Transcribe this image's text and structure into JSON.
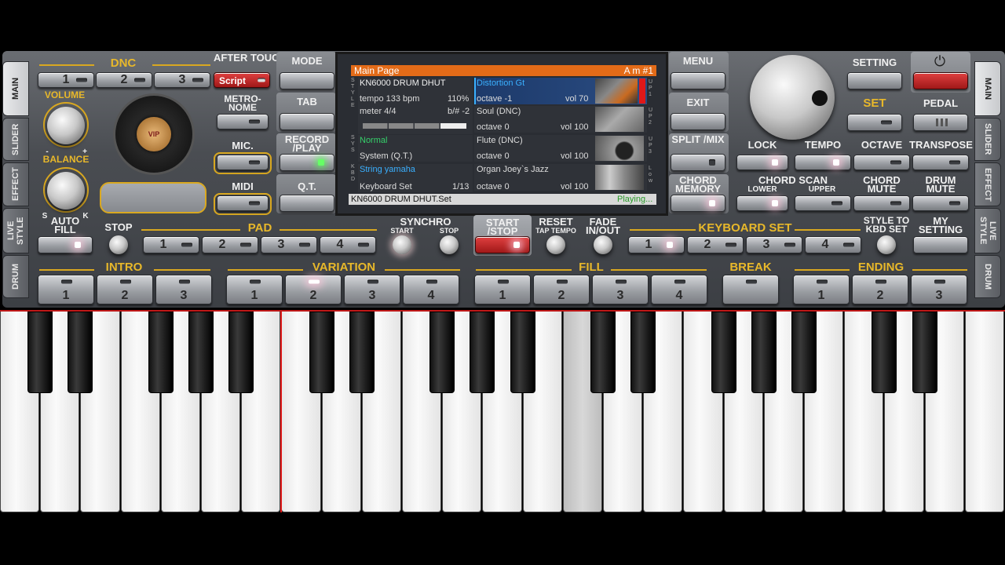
{
  "side_tabs_left": [
    "MAIN",
    "SLIDER",
    "EFFECT",
    "LIVE STYLE",
    "DRUM"
  ],
  "side_tabs_right": [
    "MAIN",
    "SLIDER",
    "EFFECT",
    "LIVE STYLE",
    "DRUM"
  ],
  "dnc": {
    "title": "DNC",
    "buttons": [
      "1",
      "2",
      "3"
    ],
    "after_touch": "AFTER TOUCH",
    "script": "Script"
  },
  "left": {
    "volume": "VOLUME",
    "balance": "BALANCE",
    "bal_minus": "-",
    "bal_plus": "+",
    "bal_s": "S",
    "bal_k": "K",
    "metronome": "METRO- NOME",
    "mic": "MIC.",
    "midi": "MIDI",
    "vip": "VIP"
  },
  "nav": {
    "mode": "MODE",
    "tab": "TAB",
    "record_play": "RECORD /PLAY",
    "qt": "Q.T.",
    "menu": "MENU",
    "exit": "EXIT",
    "split_mix": "SPLIT /MIX",
    "chord_memory": "CHORD MEMORY"
  },
  "lcd": {
    "title": "Main Page",
    "chord": "A m #1",
    "style_name": "KN6000 DRUM DHUT",
    "tempo": "tempo 133 bpm",
    "percent": "110%",
    "meter": "meter 4/4",
    "key": "b/# -2",
    "sys_name": "Normal",
    "sys_sub": "System (Q.T.)",
    "kbd_name": "String yamaha",
    "kbd_sub": "Keyboard Set",
    "kbd_count": "1/13",
    "left_labels": {
      "style": "S T Y L E",
      "sys": "S Y S",
      "kbd": "K B D"
    },
    "right_labels": [
      "U P 1",
      "U P 2",
      "U P 3",
      "L o w"
    ],
    "parts": [
      {
        "name": "Distortion Gt",
        "octave": "octave -1",
        "vol": "vol 70"
      },
      {
        "name": "Soul (DNC)",
        "octave": "octave  0",
        "vol": "vol 100"
      },
      {
        "name": "Flute (DNC)",
        "octave": "octave  0",
        "vol": "vol 100"
      },
      {
        "name": "Organ Joey`s Jazz",
        "octave": "octave  0",
        "vol": "vol 100"
      }
    ],
    "footer_file": "KN6000 DRUM DHUT.Set",
    "footer_status": "Playing..."
  },
  "right": {
    "setting": "SETTING",
    "set": "SET",
    "pedal": "PEDAL",
    "lock": "LOCK",
    "tempo": "TEMPO",
    "octave": "OCTAVE",
    "transpose": "TRANSPOSE",
    "chord_scan": "CHORD SCAN",
    "lower": "LOWER",
    "upper": "UPPER",
    "chord_mute": "CHORD MUTE",
    "drum_mute": "DRUM MUTE"
  },
  "row3": {
    "auto_fill": "AUTO FILL",
    "stop": "STOP",
    "pad": "PAD",
    "pad_buttons": [
      "1",
      "2",
      "3",
      "4"
    ],
    "synchro": "SYNCHRO",
    "synchro_start": "START",
    "synchro_stop": "STOP",
    "start_stop": "START /STOP",
    "reset": "RESET",
    "tap_tempo": "TAP TEMPO",
    "fade": "FADE IN/OUT",
    "keyboard_set": "KEYBOARD SET",
    "kbd_buttons": [
      "1",
      "2",
      "3",
      "4"
    ],
    "style_to_kbd": "STYLE TO KBD SET",
    "my_setting": "MY SETTING"
  },
  "row4": {
    "intro": "INTRO",
    "intro_buttons": [
      "1",
      "2",
      "3"
    ],
    "variation": "VARIATION",
    "variation_buttons": [
      "1",
      "2",
      "3",
      "4"
    ],
    "fill": "FILL",
    "fill_buttons": [
      "1",
      "2",
      "3",
      "4"
    ],
    "break": "BREAK",
    "ending": "ENDING",
    "ending_buttons": [
      "1",
      "2",
      "3"
    ]
  },
  "colors": {
    "accent_gold": "#e8b82a",
    "lcd_header": "#e36b18",
    "active_red": "#cc2020",
    "lcd_blue_text": "#3ab0ff",
    "lcd_green_text": "#35d06a"
  }
}
